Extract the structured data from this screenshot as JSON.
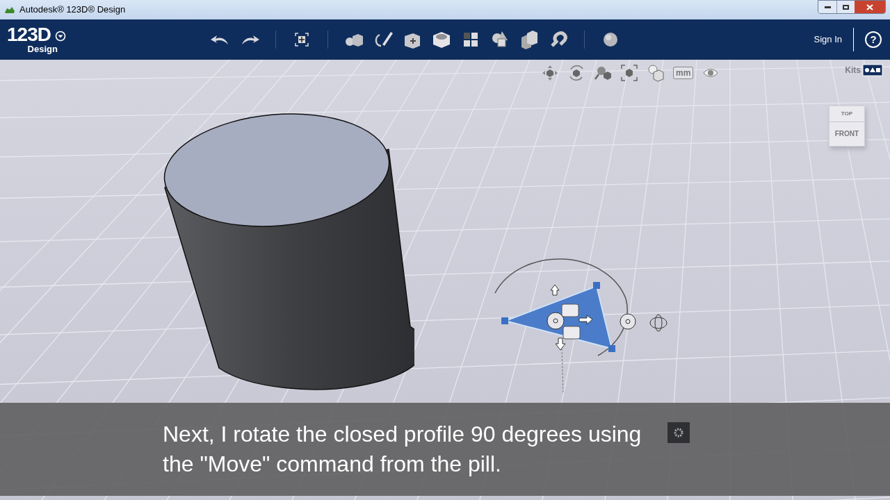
{
  "window": {
    "title": "Autodesk® 123D® Design"
  },
  "logo": {
    "main": "123D",
    "sub": "Design"
  },
  "toolbar": {
    "sign_in": "Sign In",
    "help": "?"
  },
  "view_toolbar": {
    "units": "mm",
    "kits": "Kits"
  },
  "viewcube": {
    "top": "TOP",
    "front": "FRONT"
  },
  "caption": "Next, I rotate the closed profile 90 degrees using the \"Move\" command from the pill."
}
